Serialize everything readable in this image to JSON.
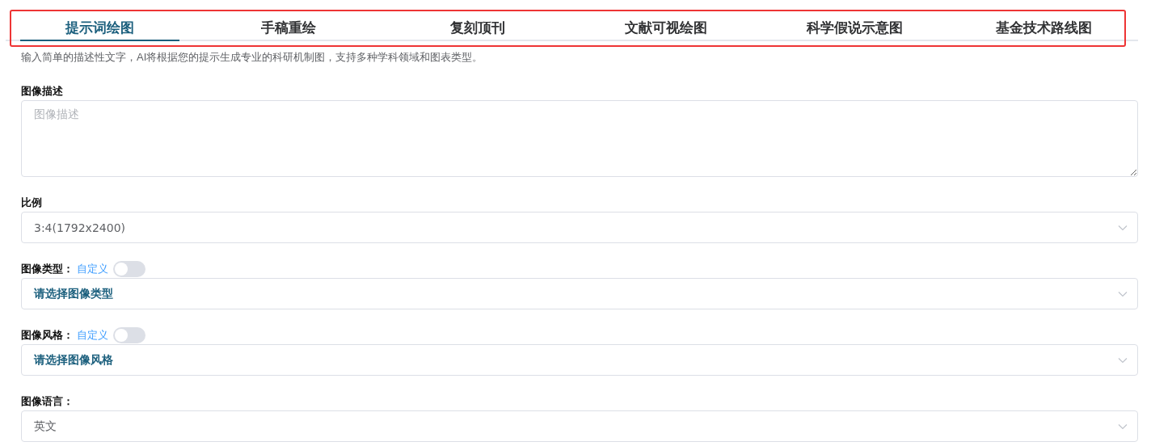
{
  "tabs": [
    {
      "label": "提示词绘图",
      "selected": true
    },
    {
      "label": "手稿重绘",
      "selected": false
    },
    {
      "label": "复刻顶刊",
      "selected": false
    },
    {
      "label": "文献可视绘图",
      "selected": false
    },
    {
      "label": "科学假说示意图",
      "selected": false
    },
    {
      "label": "基金技术路线图",
      "selected": false
    }
  ],
  "intro": "输入简单的描述性文字，AI将根据您的提示生成专业的科研机制图，支持多种学科领域和图表类型。",
  "fields": [
    {
      "kind": "textarea",
      "label": "图像描述",
      "placeholder": "图像描述"
    },
    {
      "kind": "select",
      "label": "比例",
      "value": "3:4(1792x2400)"
    },
    {
      "kind": "select",
      "label": "图像类型：",
      "custom_link": "自定义",
      "custom_on": false,
      "placeholder": "请选择图像类型"
    },
    {
      "kind": "select",
      "label": "图像风格：",
      "custom_link": "自定义",
      "custom_on": false,
      "placeholder": "请选择图像风格"
    },
    {
      "kind": "select",
      "label": "图像语言：",
      "value": "英文"
    }
  ]
}
